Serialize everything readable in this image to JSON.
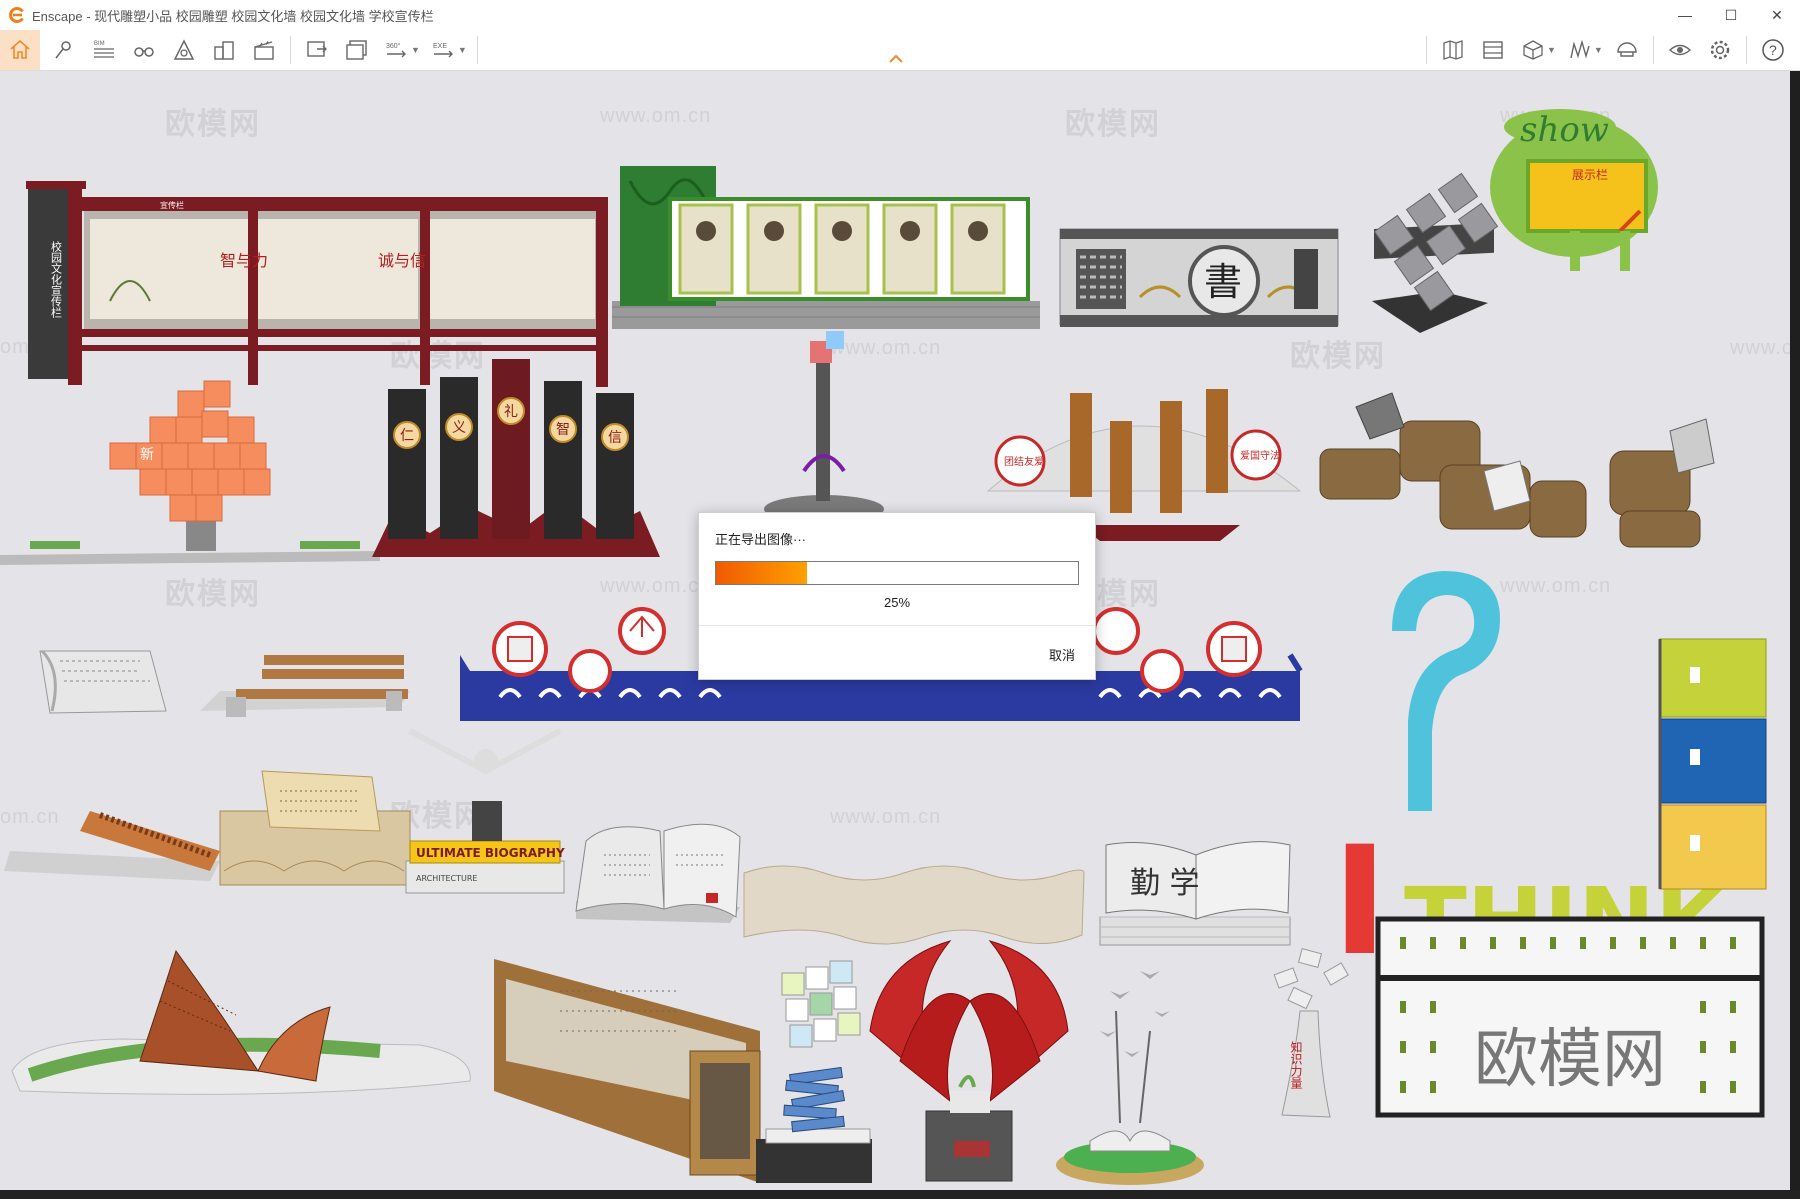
{
  "window": {
    "app_name": "Enscape",
    "title": "Enscape - 现代雕塑小品 校园雕塑 校园文化墙 校园文化墙 学校宣传栏",
    "minimize": "—",
    "maximize": "☐",
    "close": "✕"
  },
  "toolbar": {
    "left_icons": [
      "home-icon",
      "pin-icon",
      "bim-icon",
      "binoculars-icon",
      "asset-library-icon",
      "buildings-icon",
      "clapper-icon"
    ],
    "export_icons": [
      "screenshot-export-icon",
      "batch-export-icon",
      "panorama-360-icon",
      "exe-export-icon"
    ],
    "right_icons": [
      "map-icon",
      "video-editor-icon",
      "cube-view-icon",
      "pattern-icon",
      "helmet-icon",
      "eye-settings-icon",
      "gear-icon",
      "help-icon"
    ],
    "labels": {
      "bim": "BIM",
      "panorama": "360°",
      "exe": "EXE",
      "help": "?"
    }
  },
  "viewport": {
    "watermarks": [
      "欧模网",
      "www.om.cn",
      "欧模网",
      "www.om.cn",
      "欧模网",
      "www.om.cn",
      "欧模网",
      "www.om.cn",
      "欧模网",
      "www.om.cn",
      "欧模网",
      "www.om.cn",
      "欧模网",
      "www.om.cn",
      "om.cn",
      "om.cn"
    ],
    "scene_labels": {
      "board1_side": "校园文化宣传栏",
      "board1_tag": "宣传栏",
      "panel_a": "智与力",
      "panel_b": "诚与信",
      "pillars": [
        "仁",
        "义",
        "礼",
        "智",
        "信"
      ],
      "book_char": "書",
      "fan_left": "团结友爱",
      "fan_right": "爱国守法",
      "cube_glyph": "新",
      "show_sign": "show",
      "show_board": "展示栏",
      "think_word": "THINK",
      "think_letter": "I",
      "biography_book": "ULTIMATE BIOGRAPHY",
      "architecture_book": "ARCHITECTURE",
      "book_open": "勤 学",
      "knowledge_tower": "知识力量",
      "bottom_watermark": "欧模网"
    }
  },
  "dialog": {
    "title": "正在导出图像···",
    "progress_percent": 25,
    "progress_label": "25%",
    "cancel_label": "取消",
    "progress_colors": [
      "#f05a00",
      "#ffa000"
    ]
  }
}
